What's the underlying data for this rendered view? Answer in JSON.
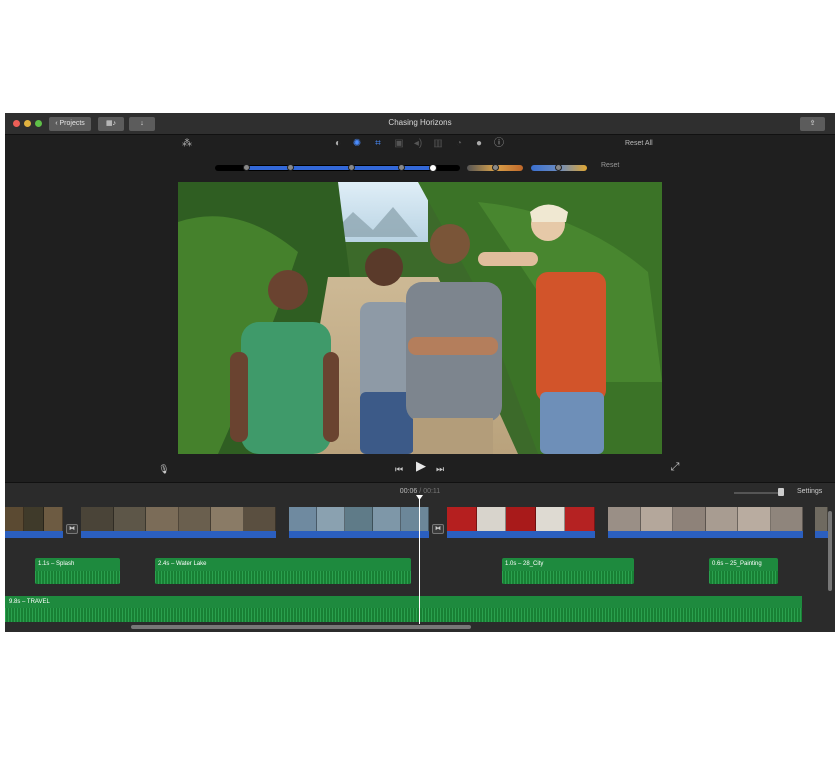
{
  "window": {
    "title": "Chasing Horizons",
    "projects_label": "Projects",
    "media_icon": "film-music-icon",
    "import_icon": "down-arrow-icon",
    "share_icon": "share-icon"
  },
  "toolbar": {
    "tools": [
      "magic-wand-icon",
      "color-balance-icon",
      "color-correction-icon",
      "crop-icon",
      "stabilization-icon",
      "volume-icon",
      "equalizer-icon",
      "speed-icon",
      "filter-icon",
      "info-icon"
    ],
    "reset_all_label": "Reset All",
    "reset_label": "Reset"
  },
  "viewer": {
    "colors": {
      "sky": "#cfe3f0",
      "foliage": "#3f7a2a",
      "road": "#c9b48f"
    }
  },
  "playback": {
    "mic_icon": "microphone-icon",
    "prev_icon": "skip-back-icon",
    "play_icon": "play-icon",
    "next_icon": "skip-forward-icon",
    "fullscreen_icon": "fullscreen-icon"
  },
  "timeline": {
    "current_time": "00:06",
    "separator": "/",
    "total_time": "00:11",
    "settings_label": "Settings",
    "video_clips": [
      {
        "name": "clip-1",
        "colors": [
          "#5b4a32",
          "#3f3a2a",
          "#6d5b42"
        ]
      },
      {
        "name": "clip-2",
        "colors": [
          "#4a4438",
          "#5d5648",
          "#7b6c58",
          "#6a5f4e",
          "#8a7b66",
          "#5a4f40"
        ]
      },
      {
        "name": "clip-3",
        "colors": [
          "#6f8aa0",
          "#8aa1b0",
          "#5f7b88",
          "#7e97a8",
          "#6c8799"
        ]
      },
      {
        "name": "clip-4",
        "colors": [
          "#b51f1f",
          "#d8d4cc",
          "#a81a1a",
          "#dedad2",
          "#b52222"
        ]
      },
      {
        "name": "clip-5",
        "colors": [
          "#9a8f86",
          "#b4a79b",
          "#8e8279",
          "#a89c91",
          "#b9aca0",
          "#8f857c"
        ]
      }
    ],
    "audio_clips": [
      {
        "label": "1.1s – Splash"
      },
      {
        "label": "2.4s – Water Lake"
      },
      {
        "label": "1.0s – 28_City"
      },
      {
        "label": "0.6s – 25_Painting"
      }
    ],
    "music_label": "9.8s – TRAVEL",
    "accent": "#2b5fbf",
    "audio_color": "#1e8a3e"
  }
}
